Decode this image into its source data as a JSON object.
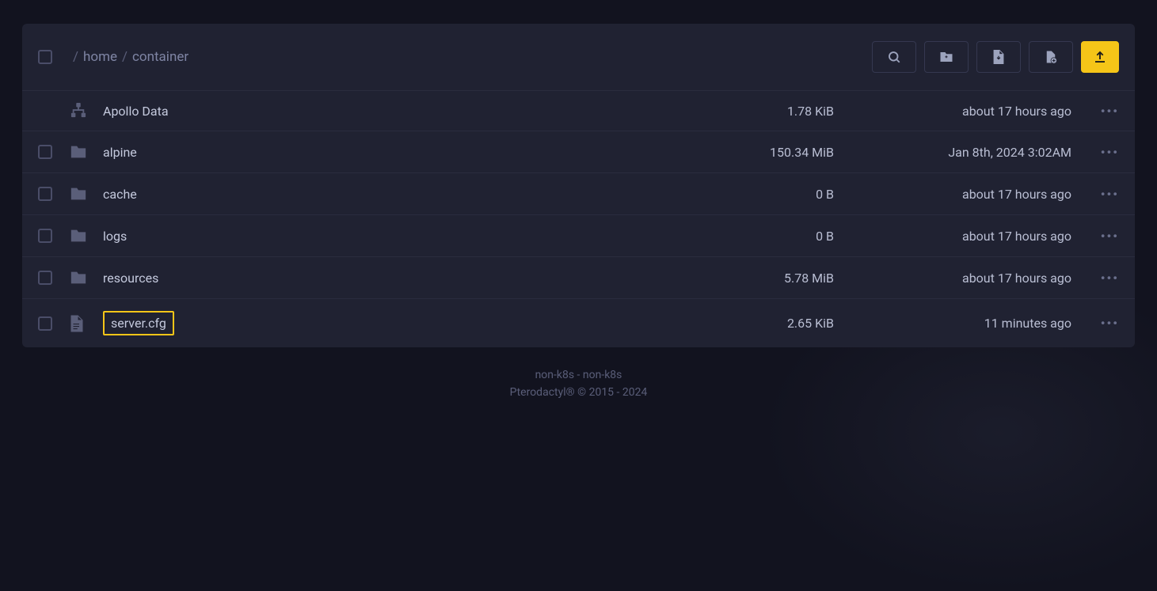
{
  "breadcrumb": {
    "sep": "/",
    "segments": [
      "home",
      "container"
    ]
  },
  "files": [
    {
      "icon": "network",
      "name": "Apollo Data",
      "size": "1.78 KiB",
      "modified": "about 17 hours ago",
      "highlighted": false,
      "checkbox": false
    },
    {
      "icon": "folder",
      "name": "alpine",
      "size": "150.34 MiB",
      "modified": "Jan 8th, 2024 3:02AM",
      "highlighted": false,
      "checkbox": true
    },
    {
      "icon": "folder",
      "name": "cache",
      "size": "0 B",
      "modified": "about 17 hours ago",
      "highlighted": false,
      "checkbox": true
    },
    {
      "icon": "folder",
      "name": "logs",
      "size": "0 B",
      "modified": "about 17 hours ago",
      "highlighted": false,
      "checkbox": true
    },
    {
      "icon": "folder",
      "name": "resources",
      "size": "5.78 MiB",
      "modified": "about 17 hours ago",
      "highlighted": false,
      "checkbox": true
    },
    {
      "icon": "file",
      "name": "server.cfg",
      "size": "2.65 KiB",
      "modified": "11 minutes ago",
      "highlighted": true,
      "checkbox": true
    }
  ],
  "footer": {
    "line1": "non-k8s - non-k8s",
    "line2": "Pterodactyl® © 2015 - 2024"
  }
}
